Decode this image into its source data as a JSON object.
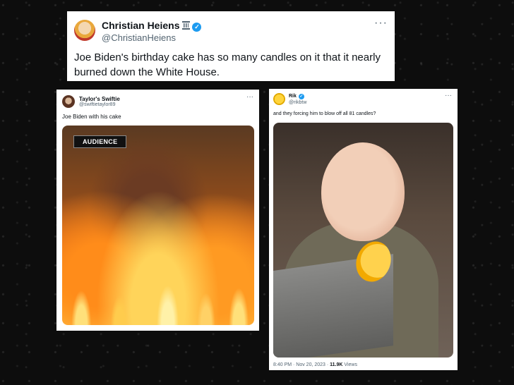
{
  "top_tweet": {
    "name": "Christian Heiens",
    "handle": "@ChristianHeiens",
    "text": "Joe Biden's birthday cake has so many candles on it that it nearly burned down the White House.",
    "more": "···"
  },
  "left_tweet": {
    "name": "Taylor's Swiftie",
    "handle": "@swiftietaylor89",
    "text": "Joe Biden with his cake",
    "more": "···",
    "media_tag": "AUDIENCE"
  },
  "right_tweet": {
    "name": "Rik",
    "handle": "@rikbtw",
    "text": "and they forcing him to blow off all 81 candles?",
    "more": "···",
    "timestamp": "8:40 PM · Nov 20, 2023 · ",
    "views_count": "11.9K",
    "views_label": " Views"
  },
  "colors": {
    "verified": "#1d9bf0",
    "background": "#0d0d0d"
  }
}
